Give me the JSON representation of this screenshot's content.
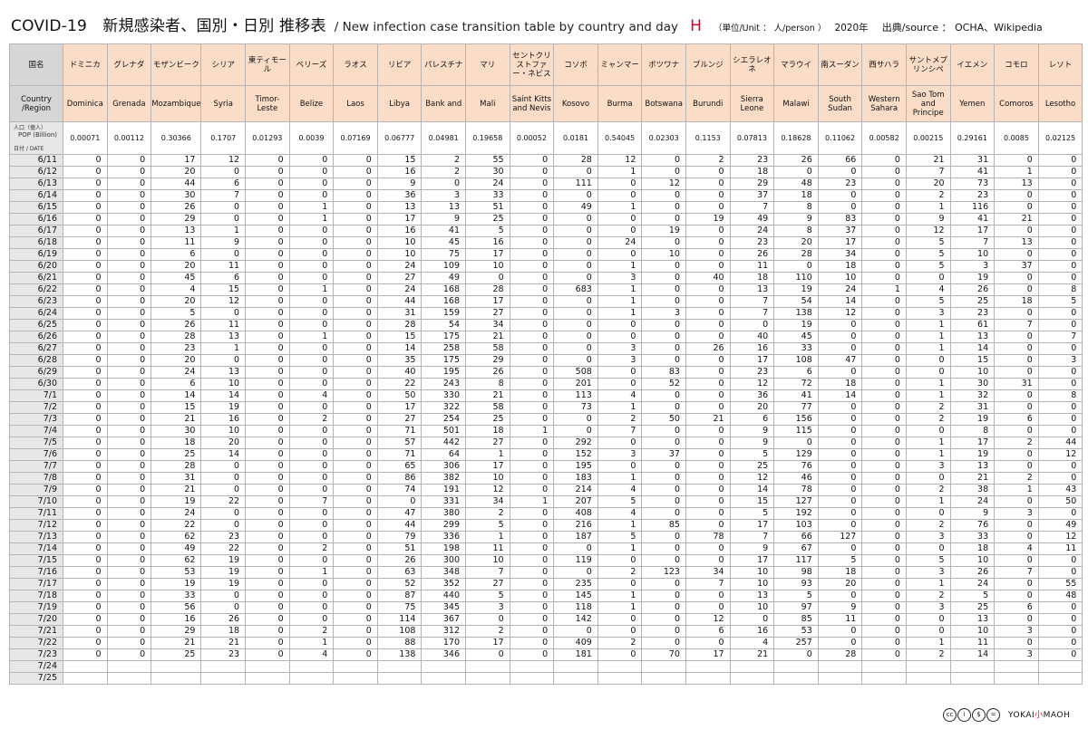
{
  "header": {
    "title_main": "COVID-19　新規感染者、国別・日別 推移表",
    "title_en": "/ New infection case transition table by country and day",
    "sheet_letter": "H",
    "unit": "（単位/Unit ： 人/person ）",
    "year": "2020年",
    "source": "出典/source ： OCHA、Wikipedia"
  },
  "table": {
    "corner_ja": "国名",
    "corner_en": "Country /Region",
    "pop_label_top": "人口（億人）",
    "pop_label_pop": "POP (Billion)",
    "pop_label_date": "日付 / DATE",
    "countries": [
      {
        "ja": "ドミニカ",
        "en": "Dominica",
        "pop": "0.00071"
      },
      {
        "ja": "グレナダ",
        "en": "Grenada",
        "pop": "0.00112"
      },
      {
        "ja": "モザンビーク",
        "en": "Mozambique",
        "pop": "0.30366"
      },
      {
        "ja": "シリア",
        "en": "Syria",
        "pop": "0.1707"
      },
      {
        "ja": "東ティモール",
        "en": "Timor-Leste",
        "pop": "0.01293"
      },
      {
        "ja": "ベリーズ",
        "en": "Belize",
        "pop": "0.0039"
      },
      {
        "ja": "ラオス",
        "en": "Laos",
        "pop": "0.07169"
      },
      {
        "ja": "リビア",
        "en": "Libya",
        "pop": "0.06777"
      },
      {
        "ja": "パレスチナ",
        "en": "Bank and",
        "pop": "0.04981"
      },
      {
        "ja": "マリ",
        "en": "Mali",
        "pop": "0.19658"
      },
      {
        "ja": "セントクリストファー・ネビス",
        "en": "Saint Kitts and Nevis",
        "pop": "0.00052"
      },
      {
        "ja": "コソボ",
        "en": "Kosovo",
        "pop": "0.0181"
      },
      {
        "ja": "ミャンマー",
        "en": "Burma",
        "pop": "0.54045"
      },
      {
        "ja": "ボツワナ",
        "en": "Botswana",
        "pop": "0.02303"
      },
      {
        "ja": "ブルンジ",
        "en": "Burundi",
        "pop": "0.1153"
      },
      {
        "ja": "シエラレオネ",
        "en": "Sierra Leone",
        "pop": "0.07813"
      },
      {
        "ja": "マラウイ",
        "en": "Malawi",
        "pop": "0.18628"
      },
      {
        "ja": "南スーダン",
        "en": "South Sudan",
        "pop": "0.11062"
      },
      {
        "ja": "西サハラ",
        "en": "Western Sahara",
        "pop": "0.00582"
      },
      {
        "ja": "サントメプリンシペ",
        "en": "Sao Tom and Principe",
        "pop": "0.00215"
      },
      {
        "ja": "イエメン",
        "en": "Yemen",
        "pop": "0.29161"
      },
      {
        "ja": "コモロ",
        "en": "Comoros",
        "pop": "0.0085"
      },
      {
        "ja": "レソト",
        "en": "Lesotho",
        "pop": "0.02125"
      }
    ],
    "rows": [
      {
        "date": "6/11",
        "v": [
          0,
          0,
          17,
          12,
          0,
          0,
          0,
          15,
          2,
          55,
          0,
          28,
          12,
          0,
          2,
          23,
          26,
          66,
          0,
          21,
          31,
          0,
          0
        ]
      },
      {
        "date": "6/12",
        "v": [
          0,
          0,
          20,
          0,
          0,
          0,
          0,
          16,
          2,
          30,
          0,
          0,
          1,
          0,
          0,
          18,
          0,
          0,
          0,
          7,
          41,
          1,
          0
        ]
      },
      {
        "date": "6/13",
        "v": [
          0,
          0,
          44,
          6,
          0,
          0,
          0,
          9,
          0,
          24,
          0,
          111,
          0,
          12,
          0,
          29,
          48,
          23,
          0,
          20,
          73,
          13,
          0
        ]
      },
      {
        "date": "6/14",
        "v": [
          0,
          0,
          30,
          7,
          0,
          0,
          0,
          36,
          3,
          33,
          0,
          0,
          0,
          0,
          0,
          37,
          18,
          0,
          0,
          2,
          23,
          0,
          0
        ]
      },
      {
        "date": "6/15",
        "v": [
          0,
          0,
          26,
          0,
          0,
          1,
          0,
          13,
          13,
          51,
          0,
          49,
          1,
          0,
          0,
          7,
          8,
          0,
          0,
          1,
          116,
          0,
          0
        ]
      },
      {
        "date": "6/16",
        "v": [
          0,
          0,
          29,
          0,
          0,
          1,
          0,
          17,
          9,
          25,
          0,
          0,
          0,
          0,
          19,
          49,
          9,
          83,
          0,
          9,
          41,
          21,
          0
        ]
      },
      {
        "date": "6/17",
        "v": [
          0,
          0,
          13,
          1,
          0,
          0,
          0,
          16,
          41,
          5,
          0,
          0,
          0,
          19,
          0,
          24,
          8,
          37,
          0,
          12,
          17,
          0,
          0
        ]
      },
      {
        "date": "6/18",
        "v": [
          0,
          0,
          11,
          9,
          0,
          0,
          0,
          10,
          45,
          16,
          0,
          0,
          24,
          0,
          0,
          23,
          20,
          17,
          0,
          5,
          7,
          13,
          0
        ]
      },
      {
        "date": "6/19",
        "v": [
          0,
          0,
          6,
          0,
          0,
          0,
          0,
          10,
          75,
          17,
          0,
          0,
          0,
          10,
          0,
          26,
          28,
          34,
          0,
          5,
          10,
          0,
          0
        ]
      },
      {
        "date": "6/20",
        "v": [
          0,
          0,
          20,
          11,
          0,
          0,
          0,
          24,
          109,
          10,
          0,
          0,
          1,
          0,
          0,
          11,
          0,
          18,
          0,
          5,
          3,
          37,
          0
        ]
      },
      {
        "date": "6/21",
        "v": [
          0,
          0,
          45,
          6,
          0,
          0,
          0,
          27,
          49,
          0,
          0,
          0,
          3,
          0,
          40,
          18,
          110,
          10,
          0,
          0,
          19,
          0,
          0
        ]
      },
      {
        "date": "6/22",
        "v": [
          0,
          0,
          4,
          15,
          0,
          1,
          0,
          24,
          168,
          28,
          0,
          683,
          1,
          0,
          0,
          13,
          19,
          24,
          1,
          4,
          26,
          0,
          8
        ]
      },
      {
        "date": "6/23",
        "v": [
          0,
          0,
          20,
          12,
          0,
          0,
          0,
          44,
          168,
          17,
          0,
          0,
          1,
          0,
          0,
          7,
          54,
          14,
          0,
          5,
          25,
          18,
          5
        ]
      },
      {
        "date": "6/24",
        "v": [
          0,
          0,
          5,
          0,
          0,
          0,
          0,
          31,
          159,
          27,
          0,
          0,
          1,
          3,
          0,
          7,
          138,
          12,
          0,
          3,
          23,
          0,
          0
        ]
      },
      {
        "date": "6/25",
        "v": [
          0,
          0,
          26,
          11,
          0,
          0,
          0,
          28,
          54,
          34,
          0,
          0,
          0,
          0,
          0,
          0,
          19,
          0,
          0,
          1,
          61,
          7,
          0
        ]
      },
      {
        "date": "6/26",
        "v": [
          0,
          0,
          28,
          13,
          0,
          1,
          0,
          15,
          175,
          21,
          0,
          0,
          0,
          0,
          0,
          40,
          45,
          0,
          0,
          1,
          13,
          0,
          7
        ]
      },
      {
        "date": "6/27",
        "v": [
          0,
          0,
          23,
          1,
          0,
          0,
          0,
          14,
          258,
          58,
          0,
          0,
          3,
          0,
          26,
          16,
          33,
          0,
          0,
          1,
          14,
          0,
          0
        ]
      },
      {
        "date": "6/28",
        "v": [
          0,
          0,
          20,
          0,
          0,
          0,
          0,
          35,
          175,
          29,
          0,
          0,
          3,
          0,
          0,
          17,
          108,
          47,
          0,
          0,
          15,
          0,
          3
        ]
      },
      {
        "date": "6/29",
        "v": [
          0,
          0,
          24,
          13,
          0,
          0,
          0,
          40,
          195,
          26,
          0,
          508,
          0,
          83,
          0,
          23,
          6,
          0,
          0,
          0,
          10,
          0,
          0
        ]
      },
      {
        "date": "6/30",
        "v": [
          0,
          0,
          6,
          10,
          0,
          0,
          0,
          22,
          243,
          8,
          0,
          201,
          0,
          52,
          0,
          12,
          72,
          18,
          0,
          1,
          30,
          31,
          0
        ]
      },
      {
        "date": "7/1",
        "v": [
          0,
          0,
          14,
          14,
          0,
          4,
          0,
          50,
          330,
          21,
          0,
          113,
          4,
          0,
          0,
          36,
          41,
          14,
          0,
          1,
          32,
          0,
          8
        ]
      },
      {
        "date": "7/2",
        "v": [
          0,
          0,
          15,
          19,
          0,
          0,
          0,
          17,
          322,
          58,
          0,
          73,
          1,
          0,
          0,
          20,
          77,
          0,
          0,
          2,
          31,
          0,
          0
        ]
      },
      {
        "date": "7/3",
        "v": [
          0,
          0,
          21,
          16,
          0,
          2,
          0,
          27,
          254,
          25,
          0,
          0,
          2,
          50,
          21,
          6,
          156,
          0,
          0,
          2,
          19,
          6,
          0
        ]
      },
      {
        "date": "7/4",
        "v": [
          0,
          0,
          30,
          10,
          0,
          0,
          0,
          71,
          501,
          18,
          1,
          0,
          7,
          0,
          0,
          9,
          115,
          0,
          0,
          0,
          8,
          0,
          0
        ]
      },
      {
        "date": "7/5",
        "v": [
          0,
          0,
          18,
          20,
          0,
          0,
          0,
          57,
          442,
          27,
          0,
          292,
          0,
          0,
          0,
          9,
          0,
          0,
          0,
          1,
          17,
          2,
          44
        ]
      },
      {
        "date": "7/6",
        "v": [
          0,
          0,
          25,
          14,
          0,
          0,
          0,
          71,
          64,
          1,
          0,
          152,
          3,
          37,
          0,
          5,
          129,
          0,
          0,
          1,
          19,
          0,
          12
        ]
      },
      {
        "date": "7/7",
        "v": [
          0,
          0,
          28,
          0,
          0,
          0,
          0,
          65,
          306,
          17,
          0,
          195,
          0,
          0,
          0,
          25,
          76,
          0,
          0,
          3,
          13,
          0,
          0
        ]
      },
      {
        "date": "7/8",
        "v": [
          0,
          0,
          31,
          0,
          0,
          0,
          0,
          86,
          382,
          10,
          0,
          183,
          1,
          0,
          0,
          12,
          46,
          0,
          0,
          0,
          21,
          2,
          0
        ]
      },
      {
        "date": "7/9",
        "v": [
          0,
          0,
          21,
          0,
          0,
          0,
          0,
          74,
          191,
          12,
          0,
          214,
          4,
          0,
          0,
          14,
          78,
          0,
          0,
          2,
          38,
          1,
          43
        ]
      },
      {
        "date": "7/10",
        "v": [
          0,
          0,
          19,
          22,
          0,
          7,
          0,
          0,
          331,
          34,
          1,
          207,
          5,
          0,
          0,
          15,
          127,
          0,
          0,
          1,
          24,
          0,
          50
        ]
      },
      {
        "date": "7/11",
        "v": [
          0,
          0,
          24,
          0,
          0,
          0,
          0,
          47,
          380,
          2,
          0,
          408,
          4,
          0,
          0,
          5,
          192,
          0,
          0,
          0,
          9,
          3,
          0
        ]
      },
      {
        "date": "7/12",
        "v": [
          0,
          0,
          22,
          0,
          0,
          0,
          0,
          44,
          299,
          5,
          0,
          216,
          1,
          85,
          0,
          17,
          103,
          0,
          0,
          2,
          76,
          0,
          49
        ]
      },
      {
        "date": "7/13",
        "v": [
          0,
          0,
          62,
          23,
          0,
          0,
          0,
          79,
          336,
          1,
          0,
          187,
          5,
          0,
          78,
          7,
          66,
          127,
          0,
          3,
          33,
          0,
          12
        ]
      },
      {
        "date": "7/14",
        "v": [
          0,
          0,
          49,
          22,
          0,
          2,
          0,
          51,
          198,
          11,
          0,
          0,
          1,
          0,
          0,
          9,
          67,
          0,
          0,
          0,
          18,
          4,
          11
        ]
      },
      {
        "date": "7/15",
        "v": [
          0,
          0,
          62,
          19,
          0,
          0,
          0,
          26,
          300,
          10,
          0,
          119,
          0,
          0,
          0,
          17,
          117,
          5,
          0,
          5,
          10,
          0,
          0
        ]
      },
      {
        "date": "7/16",
        "v": [
          0,
          0,
          53,
          19,
          0,
          1,
          0,
          63,
          348,
          7,
          0,
          0,
          2,
          123,
          34,
          10,
          98,
          18,
          0,
          3,
          26,
          7,
          0
        ]
      },
      {
        "date": "7/17",
        "v": [
          0,
          0,
          19,
          19,
          0,
          0,
          0,
          52,
          352,
          27,
          0,
          235,
          0,
          0,
          7,
          10,
          93,
          20,
          0,
          1,
          24,
          0,
          55
        ]
      },
      {
        "date": "7/18",
        "v": [
          0,
          0,
          33,
          0,
          0,
          0,
          0,
          87,
          440,
          5,
          0,
          145,
          1,
          0,
          0,
          13,
          5,
          0,
          0,
          2,
          5,
          0,
          48
        ]
      },
      {
        "date": "7/19",
        "v": [
          0,
          0,
          56,
          0,
          0,
          0,
          0,
          75,
          345,
          3,
          0,
          118,
          1,
          0,
          0,
          10,
          97,
          9,
          0,
          3,
          25,
          6,
          0
        ]
      },
      {
        "date": "7/20",
        "v": [
          0,
          0,
          16,
          26,
          0,
          0,
          0,
          114,
          367,
          0,
          0,
          142,
          0,
          0,
          12,
          0,
          85,
          11,
          0,
          0,
          13,
          0,
          0
        ]
      },
      {
        "date": "7/21",
        "v": [
          0,
          0,
          29,
          18,
          0,
          2,
          0,
          108,
          312,
          2,
          0,
          0,
          0,
          0,
          6,
          16,
          53,
          0,
          0,
          0,
          10,
          3,
          0
        ]
      },
      {
        "date": "7/22",
        "v": [
          0,
          0,
          21,
          21,
          0,
          1,
          0,
          88,
          170,
          17,
          0,
          409,
          2,
          0,
          0,
          4,
          257,
          0,
          0,
          1,
          11,
          0,
          0
        ]
      },
      {
        "date": "7/23",
        "v": [
          0,
          0,
          25,
          23,
          0,
          4,
          0,
          138,
          346,
          0,
          0,
          181,
          0,
          70,
          17,
          21,
          0,
          28,
          0,
          2,
          14,
          3,
          0
        ]
      },
      {
        "date": "7/24",
        "v": []
      },
      {
        "date": "7/25",
        "v": []
      }
    ]
  },
  "footer": {
    "license_icons": [
      "cc-icon",
      "by-icon",
      "nc-icon",
      "nd-icon"
    ],
    "license_glyphs": [
      "cc",
      "i",
      "$",
      "="
    ],
    "brand_a": "YOKAI",
    "brand_b": "小",
    "brand_c": "MAOH"
  }
}
